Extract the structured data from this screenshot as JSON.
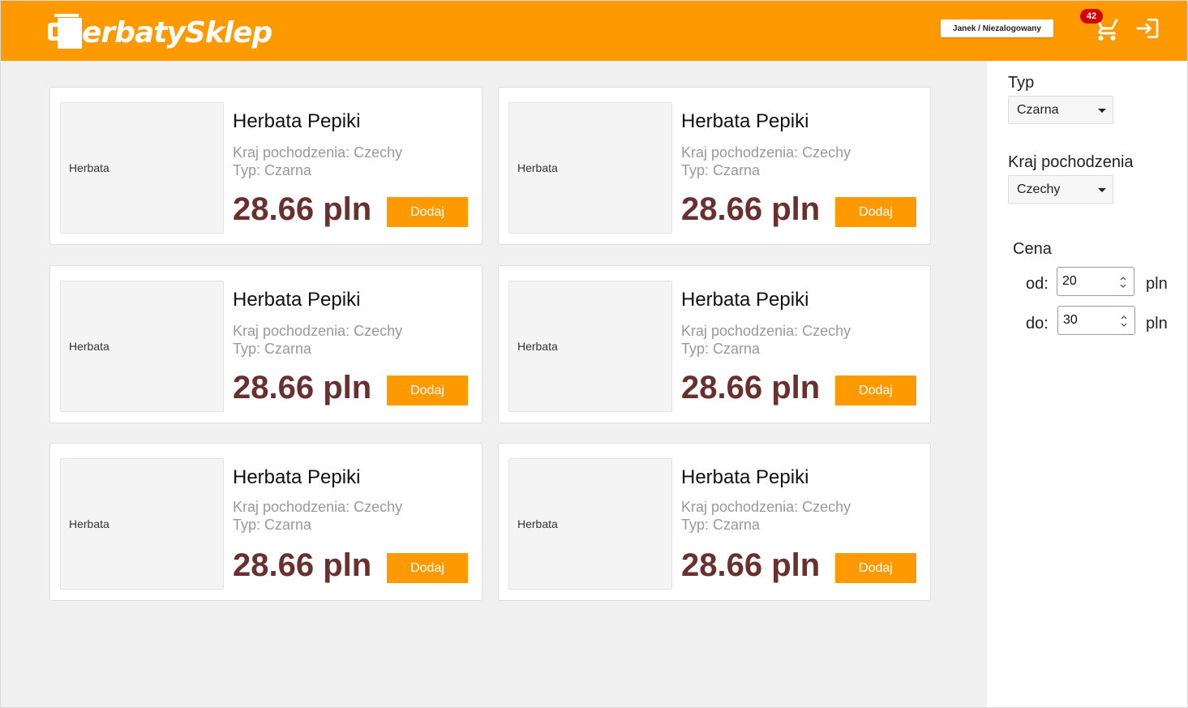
{
  "header": {
    "logo_text": "erbatySklep",
    "user_label": "Janek / Niezalogowany",
    "cart_count": "42",
    "brand_color": "#ff9900",
    "icons": [
      "cart-icon",
      "login-icon",
      "teapot-logo-icon"
    ]
  },
  "sidebar": {
    "type_label": "Typ",
    "type_value": "Czarna",
    "country_label": "Kraj pochodzenia",
    "country_value": "Czechy",
    "price_label": "Cena",
    "from_label": "od:",
    "from_value": "20",
    "to_label": "do:",
    "to_value": "30",
    "currency": "pln"
  },
  "products": [
    {
      "image_alt": "Herbata",
      "title": "Herbata Pepiki",
      "country": "Kraj pochodzenia: Czechy",
      "type": "Typ: Czarna",
      "price": "28.66 pln",
      "add_label": "Dodaj"
    },
    {
      "image_alt": "Herbata",
      "title": "Herbata Pepiki",
      "country": "Kraj pochodzenia: Czechy",
      "type": "Typ: Czarna",
      "price": "28.66 pln",
      "add_label": "Dodaj"
    },
    {
      "image_alt": "Herbata",
      "title": "Herbata Pepiki",
      "country": "Kraj pochodzenia: Czechy",
      "type": "Typ: Czarna",
      "price": "28.66 pln",
      "add_label": "Dodaj"
    },
    {
      "image_alt": "Herbata",
      "title": "Herbata Pepiki",
      "country": "Kraj pochodzenia: Czechy",
      "type": "Typ: Czarna",
      "price": "28.66 pln",
      "add_label": "Dodaj"
    },
    {
      "image_alt": "Herbata",
      "title": "Herbata Pepiki",
      "country": "Kraj pochodzenia: Czechy",
      "type": "Typ: Czarna",
      "price": "28.66 pln",
      "add_label": "Dodaj"
    },
    {
      "image_alt": "Herbata",
      "title": "Herbata Pepiki",
      "country": "Kraj pochodzenia: Czechy",
      "type": "Typ: Czarna",
      "price": "28.66 pln",
      "add_label": "Dodaj"
    }
  ]
}
